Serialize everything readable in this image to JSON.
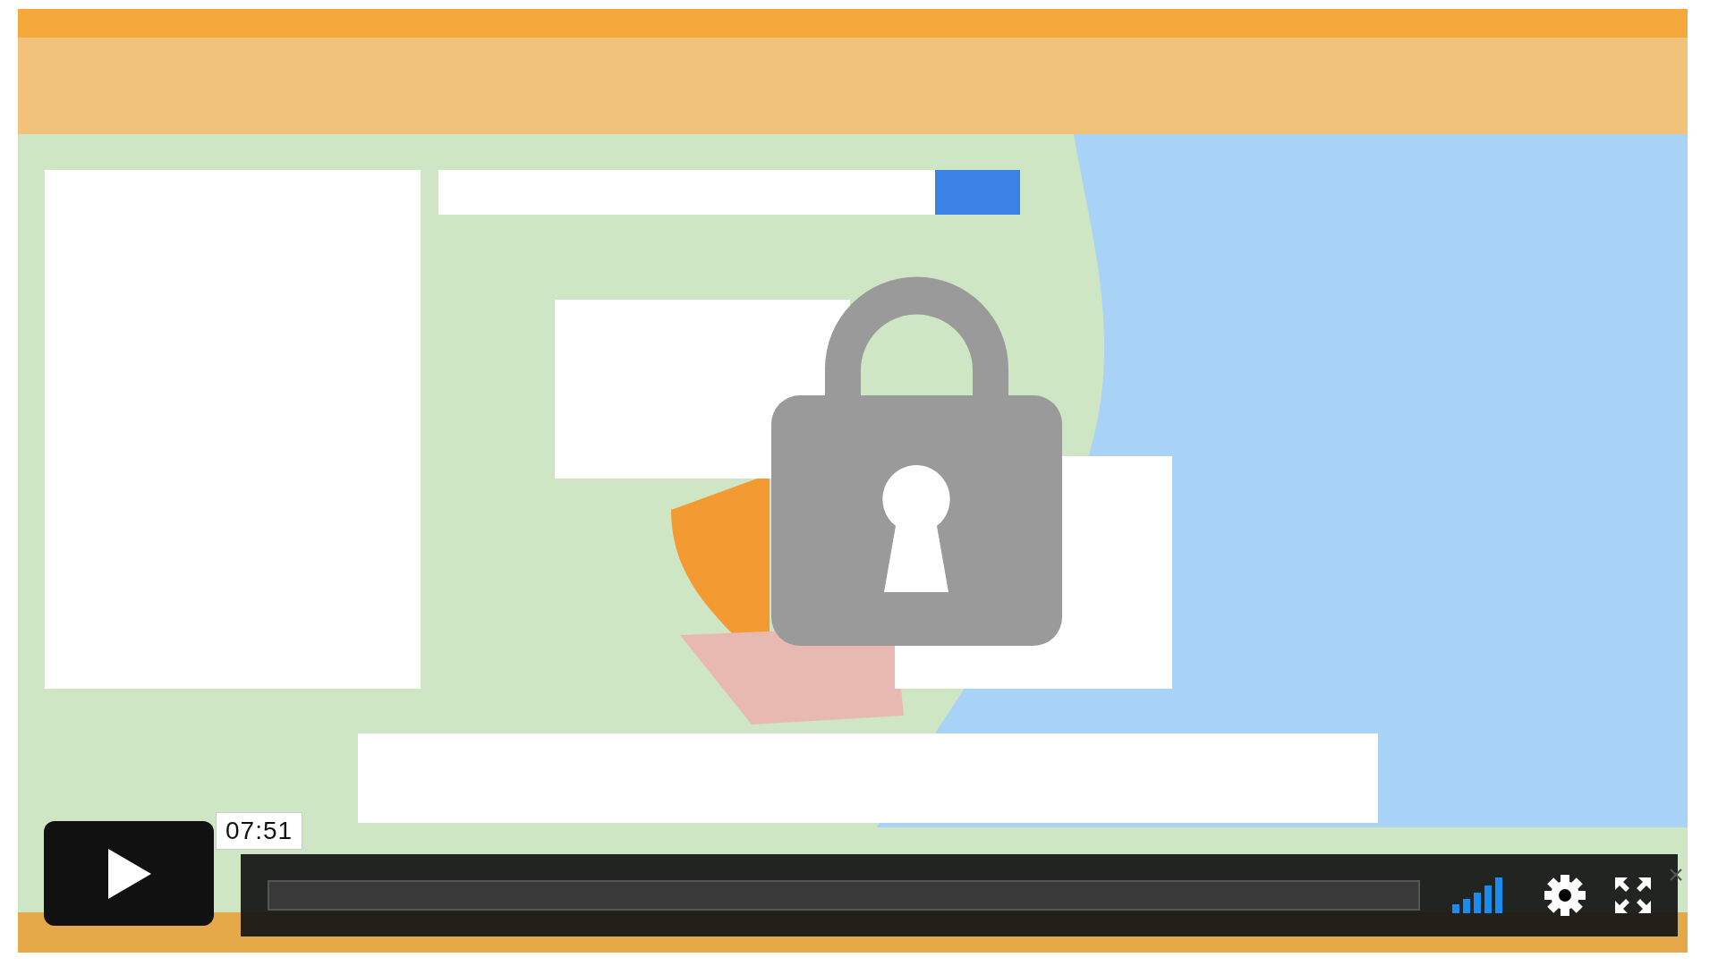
{
  "player": {
    "locked": true,
    "playing": false,
    "time": "07:51",
    "progress": {
      "level": 0
    }
  }
}
